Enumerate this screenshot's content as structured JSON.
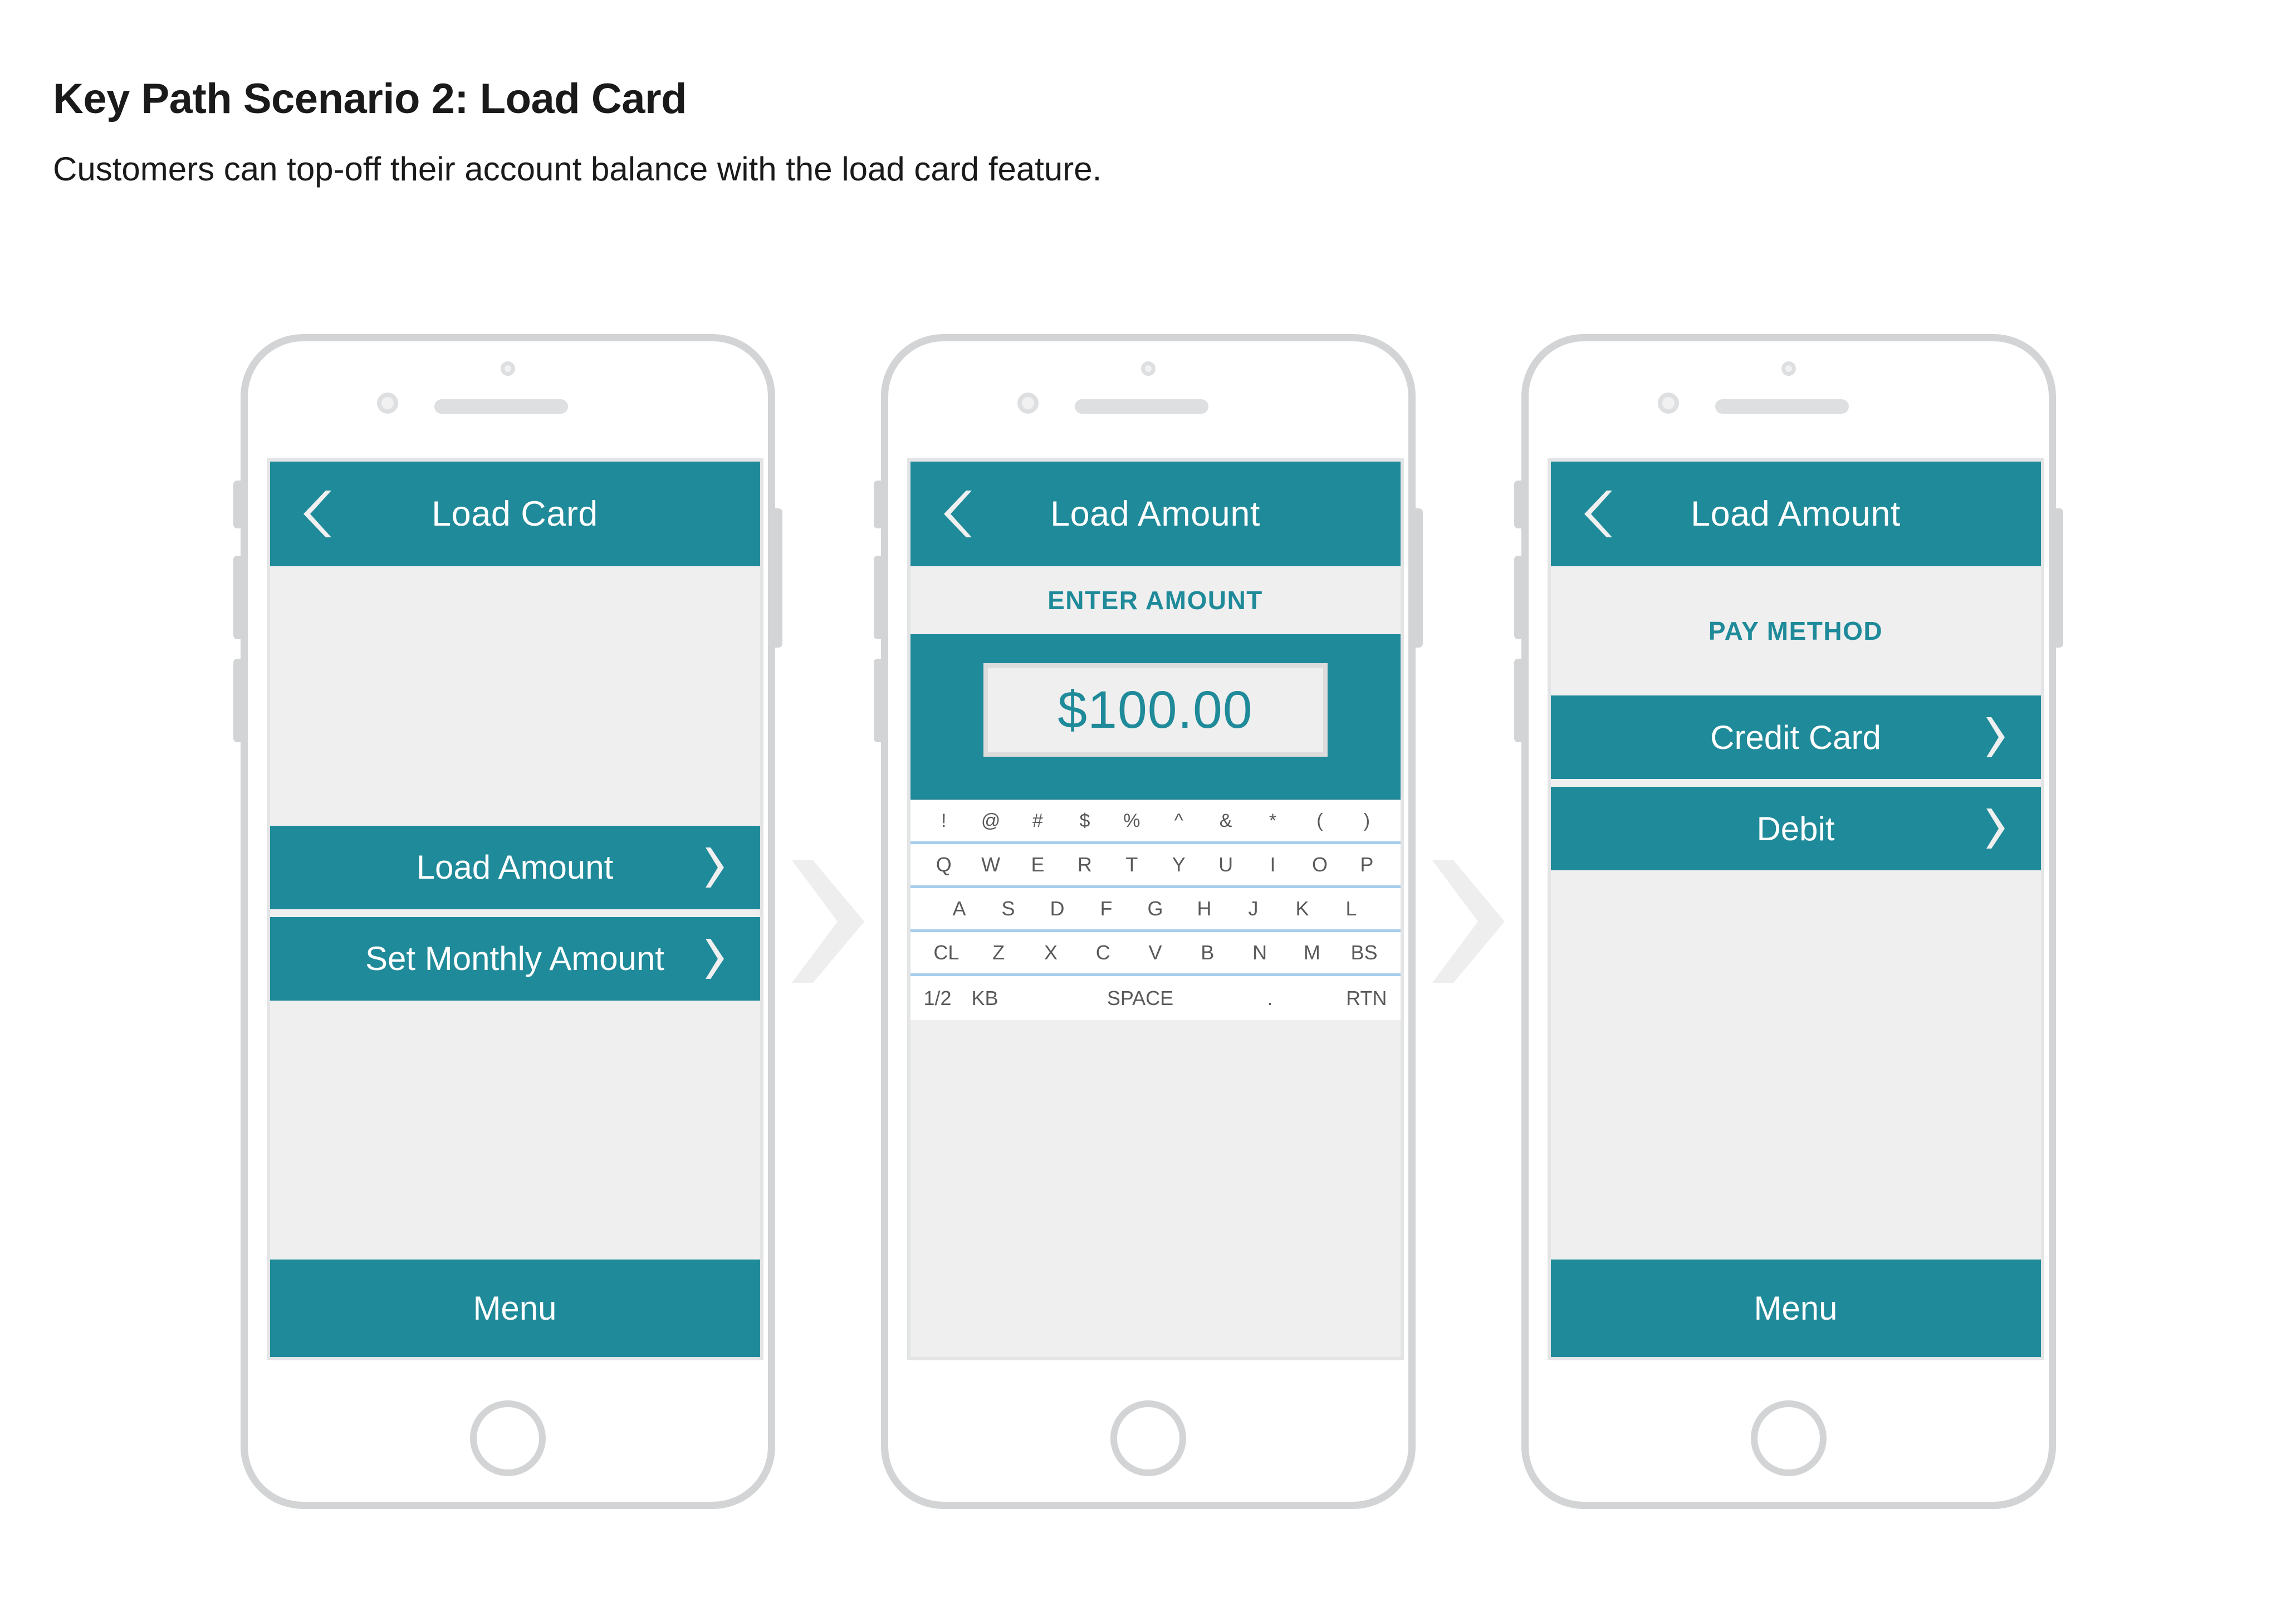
{
  "header": {
    "title": "Key Path Scenario 2: Load Card",
    "subtitle": "Customers can top-off their account balance with the load card feature."
  },
  "colors": {
    "teal": "#1f8a99",
    "screen_bg": "#efefef",
    "frame": "#d2d4d5",
    "keyboard_divider": "#a8cdea",
    "flow_arrow": "#eeeeee"
  },
  "screens": [
    {
      "nav_title": "Load Card",
      "back_icon": "chevron-left-icon",
      "rows": [
        {
          "label": "Load Amount",
          "chevron": "chevron-right-icon"
        },
        {
          "label": "Set Monthly Amount",
          "chevron": "chevron-right-icon"
        }
      ],
      "menu_label": "Menu"
    },
    {
      "nav_title": "Load Amount",
      "back_icon": "chevron-left-icon",
      "section_label": "ENTER AMOUNT",
      "amount_value": "$100.00",
      "keyboard": {
        "symbols": [
          "!",
          "@",
          "#",
          "$",
          "%",
          "^",
          "&",
          "*",
          "(",
          ")"
        ],
        "row1": [
          "Q",
          "W",
          "E",
          "R",
          "T",
          "Y",
          "U",
          "I",
          "O",
          "P"
        ],
        "row2": [
          "A",
          "S",
          "D",
          "F",
          "G",
          "H",
          "J",
          "K",
          "L"
        ],
        "row3": [
          "CL",
          "Z",
          "X",
          "C",
          "V",
          "B",
          "N",
          "M",
          "BS"
        ],
        "row4": [
          "1/2",
          "KB",
          "SPACE",
          ".",
          "RTN"
        ]
      }
    },
    {
      "nav_title": "Load Amount",
      "back_icon": "chevron-left-icon",
      "section_label": "PAY METHOD",
      "rows": [
        {
          "label": "Credit Card",
          "chevron": "chevron-right-icon"
        },
        {
          "label": "Debit",
          "chevron": "chevron-right-icon"
        }
      ],
      "menu_label": "Menu"
    }
  ]
}
